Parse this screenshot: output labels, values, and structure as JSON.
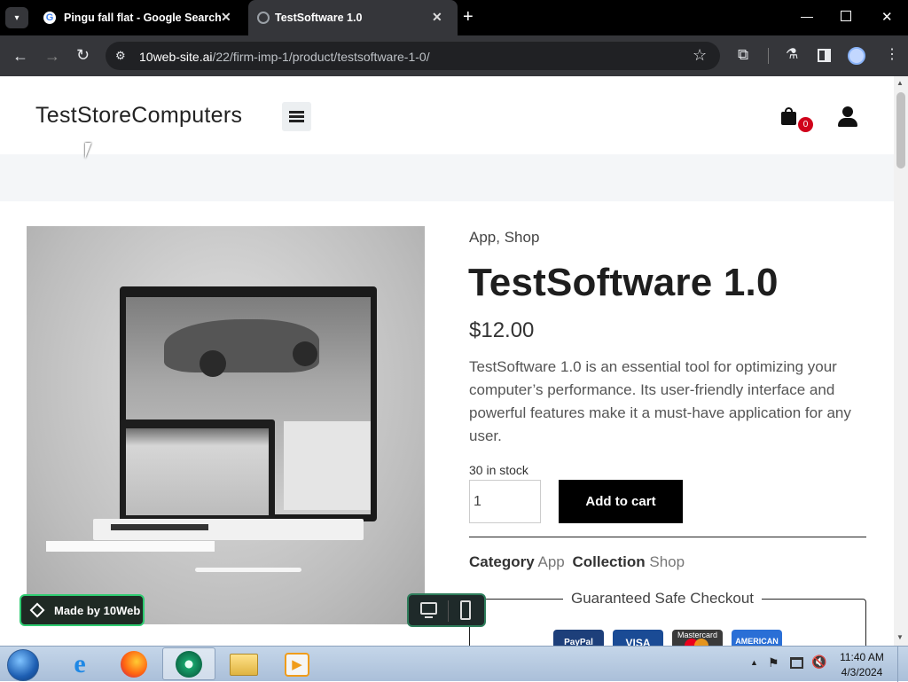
{
  "browser": {
    "tabs": [
      {
        "label": "Pingu fall flat - Google Search",
        "active": false
      },
      {
        "label": "TestSoftware 1.0",
        "active": true
      }
    ],
    "url_domain": "10web-site.ai",
    "url_path": "/22/firm-imp-1/product/testsoftware-1-0/"
  },
  "site": {
    "logo": "TestStoreComputers",
    "cart_count": "0"
  },
  "product": {
    "breadcrumb_cat1": "App",
    "breadcrumb_sep": ",",
    "breadcrumb_cat2": "Shop",
    "title": "TestSoftware 1.0",
    "price": "$12.00",
    "description": "TestSoftware 1.0 is an essential tool for optimizing your computer’s performance. Its user-friendly interface and powerful features make it a must-have application for any user.",
    "stock": "30 in stock",
    "quantity": "1",
    "add_to_cart": "Add to cart",
    "category_label": "Category",
    "category_value": "App",
    "collection_label": "Collection",
    "collection_value": "Shop",
    "safe_checkout": "Guaranteed Safe Checkout",
    "payment_methods": [
      "PayPal",
      "VISA",
      "Mastercard",
      "AMERICAN"
    ]
  },
  "badge": {
    "made_by": "Made by 10Web"
  },
  "taskbar": {
    "time": "11:40 AM",
    "date": "4/3/2024"
  },
  "colors": {
    "accent_dark": "#000000",
    "badge_bg": "#1f2a24",
    "badge_border": "#2ecc71",
    "cart_badge": "#d0021b"
  }
}
